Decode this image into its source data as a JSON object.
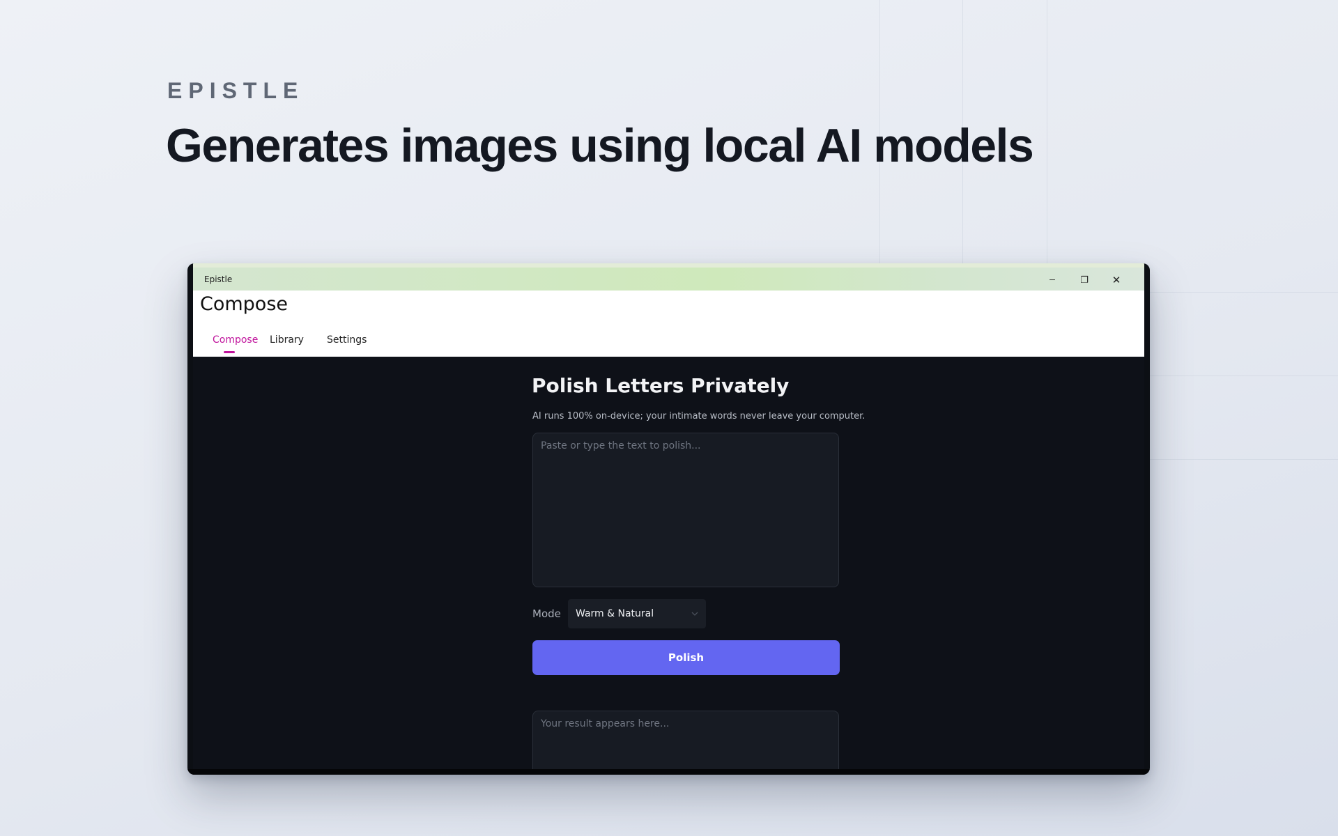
{
  "hero": {
    "brand": "EPISTLE",
    "headline": "Generates images using local AI models"
  },
  "window": {
    "title": "Epistle",
    "controls": {
      "minimize_glyph": "─",
      "maximize_glyph": "❐",
      "close_glyph": "✕"
    }
  },
  "appbar": {
    "page_title": "Compose",
    "tabs": [
      {
        "label": "Compose",
        "active": true
      },
      {
        "label": "Library",
        "active": false
      },
      {
        "label": "Settings",
        "active": false
      }
    ],
    "accent": "#c0149c"
  },
  "main": {
    "title": "Polish Letters Privately",
    "subtitle": "AI runs 100% on-device; your intimate words never leave your computer.",
    "input": {
      "placeholder": "Paste or type the text to polish...",
      "value": ""
    },
    "mode": {
      "label": "Mode",
      "selected": "Warm & Natural",
      "icon": "chevron-down-icon"
    },
    "polish_button": {
      "label": "Polish",
      "color": "#6366f1"
    },
    "result": {
      "placeholder": "Your result appears here...",
      "value": ""
    }
  }
}
